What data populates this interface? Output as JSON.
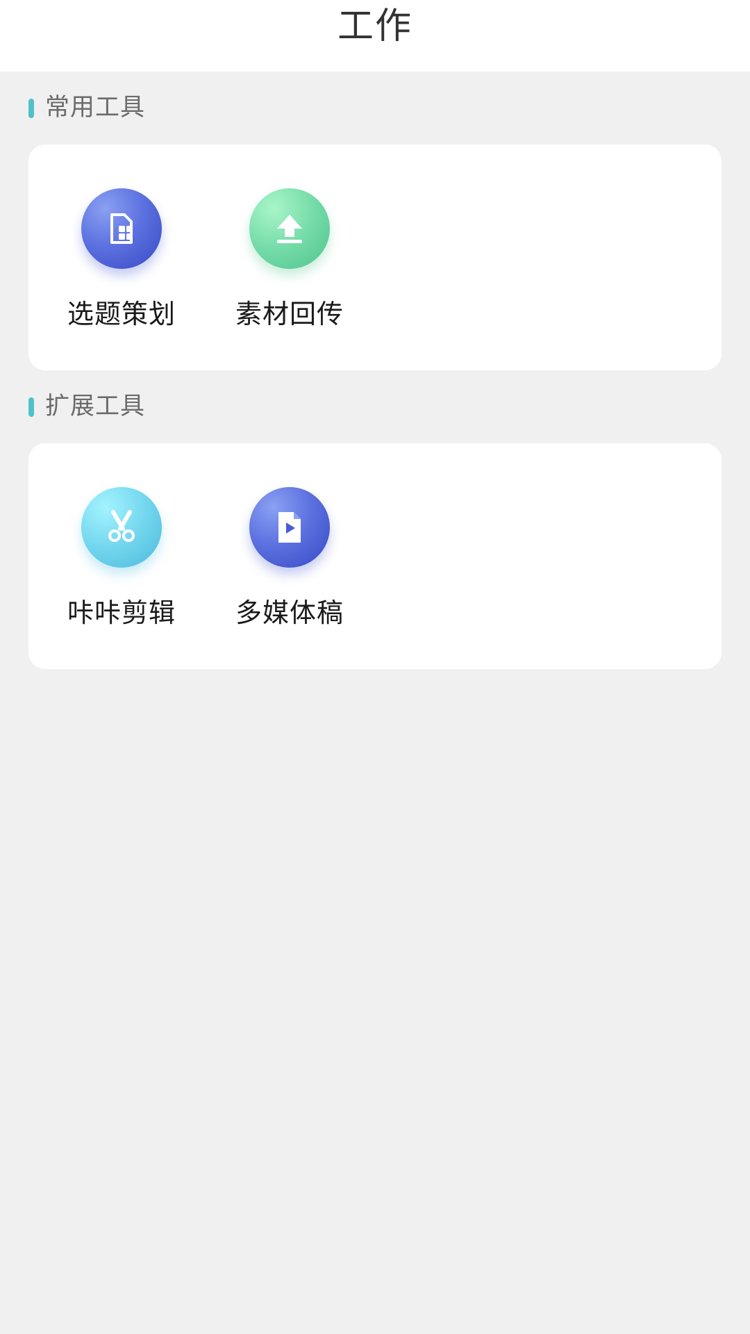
{
  "header": {
    "title": "工作"
  },
  "sections": [
    {
      "title": "常用工具",
      "tools": [
        {
          "label": "选题策划",
          "icon": "topic-planning-icon",
          "color": "#4a5bd6"
        },
        {
          "label": "素材回传",
          "icon": "upload-icon",
          "color": "#5fcf9a"
        }
      ]
    },
    {
      "title": "扩展工具",
      "tools": [
        {
          "label": "咔咔剪辑",
          "icon": "scissors-icon",
          "color": "#5ec4e4"
        },
        {
          "label": "多媒体稿",
          "icon": "video-file-icon",
          "color": "#4a5bd6"
        }
      ]
    }
  ],
  "colors": {
    "accent": "#4fc1c9",
    "background": "#f0f0f0",
    "card": "#ffffff"
  }
}
